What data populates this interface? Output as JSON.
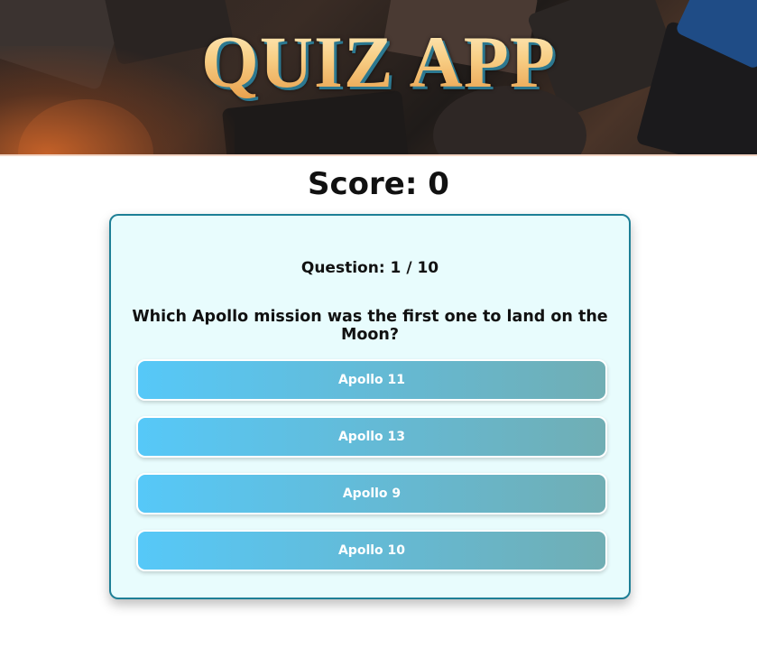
{
  "header": {
    "title": "QUIZ APP"
  },
  "score": {
    "label": "Score:",
    "value": "0"
  },
  "quiz": {
    "counter_label": "Question:",
    "current": "1",
    "separator": "/",
    "total": "10",
    "question": "Which Apollo mission was the first one to land on the Moon?",
    "options": [
      {
        "label": "Apollo 11"
      },
      {
        "label": "Apollo 13"
      },
      {
        "label": "Apollo 9"
      },
      {
        "label": "Apollo 10"
      }
    ]
  },
  "colors": {
    "card_border": "#1e7f96",
    "card_bg": "#e8fcfd",
    "option_gradient_start": "#56c8f8",
    "option_gradient_end": "#70aeb4",
    "title_gold": "#f6c57e",
    "title_shadow": "#2c7890"
  }
}
